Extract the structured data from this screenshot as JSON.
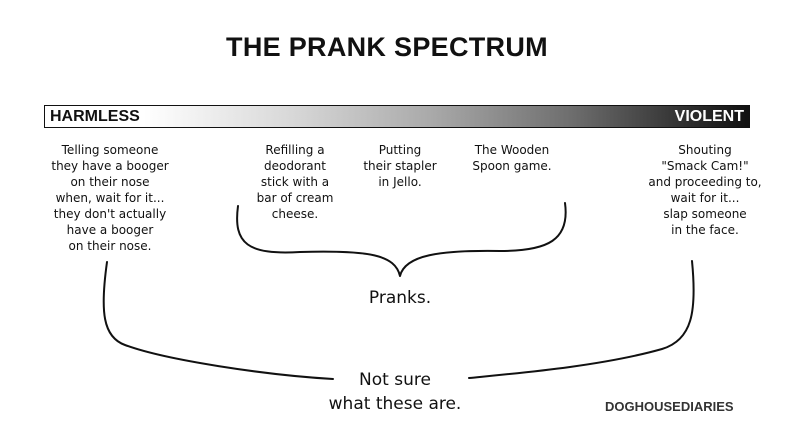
{
  "title": "THE PRANK SPECTRUM",
  "spectrum": {
    "left_label": "HARMLESS",
    "right_label": "VIOLENT"
  },
  "examples": [
    {
      "name": "booger",
      "lines": [
        "Telling someone",
        "they have a booger",
        "on their nose",
        "when, wait for it...",
        "they don't actually",
        "have a booger",
        "on their nose."
      ]
    },
    {
      "name": "deodorant",
      "lines": [
        "Refilling a",
        "deodorant",
        "stick with a",
        "bar of cream",
        "cheese."
      ]
    },
    {
      "name": "stapler",
      "lines": [
        "Putting",
        "their stapler",
        "in Jello."
      ]
    },
    {
      "name": "wooden-spoon",
      "lines": [
        "The Wooden",
        "Spoon game."
      ]
    },
    {
      "name": "smack-cam",
      "lines": [
        "Shouting",
        "\"Smack Cam!\"",
        "and proceeding to,",
        "wait for it...",
        "slap someone",
        "in the face."
      ]
    }
  ],
  "pranks_label": "Pranks.",
  "unsure_label_lines": [
    "Not sure",
    "what these are."
  ],
  "credit": "DOGHOUSEDIARIES"
}
